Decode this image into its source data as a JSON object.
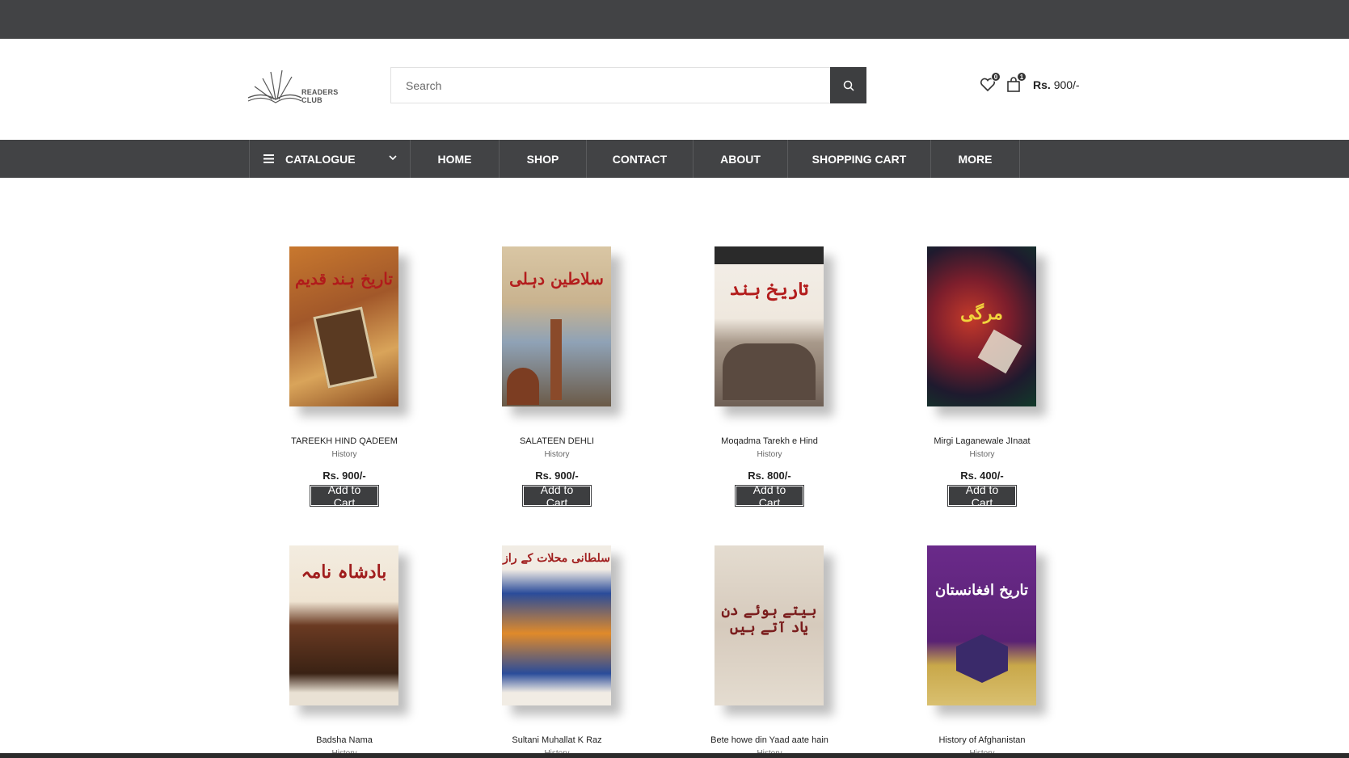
{
  "header": {
    "logo_text": "READERS CLUB",
    "search_placeholder": "Search",
    "wishlist_count": "0",
    "cart_count": "1",
    "cart_currency": "Rs.",
    "cart_amount": "900/-"
  },
  "nav": {
    "catalogue": "CATALOGUE",
    "items": [
      "HOME",
      "SHOP",
      "CONTACT",
      "ABOUT",
      "SHOPPING CART",
      "MORE"
    ]
  },
  "products": [
    {
      "name": "TAREEKH HIND QADEEM",
      "category": "History",
      "price": "Rs. 900/-",
      "button": "Add to Cart",
      "cover_text": "تاریخ ہند قدیم"
    },
    {
      "name": "SALATEEN DEHLI",
      "category": "History",
      "price": "Rs. 900/-",
      "button": "Add to Cart",
      "cover_text": "سلاطین دہلی"
    },
    {
      "name": "Moqadma Tarekh e Hind",
      "category": "History",
      "price": "Rs. 800/-",
      "button": "Add to Cart",
      "cover_text": "تاریخ ہند"
    },
    {
      "name": "Mirgi Laganewale JInaat",
      "category": "History",
      "price": "Rs. 400/-",
      "button": "Add to Cart",
      "cover_text": "مرگی"
    },
    {
      "name": "Badsha Nama",
      "category": "History",
      "cover_text": "بادشاہ نامہ"
    },
    {
      "name": "Sultani Muhallat K Raz",
      "category": "History",
      "cover_text": "سلطانی محلات کے راز"
    },
    {
      "name": "Bete howe din Yaad aate hain",
      "category": "History",
      "cover_text": "بیتے ہوئے دن یاد آتے ہیں"
    },
    {
      "name": "History of Afghanistan",
      "category": "History",
      "cover_text": "تاریخ افغانستان"
    }
  ],
  "colors": {
    "dark_bar": "#424345",
    "button": "#3d3e40"
  }
}
